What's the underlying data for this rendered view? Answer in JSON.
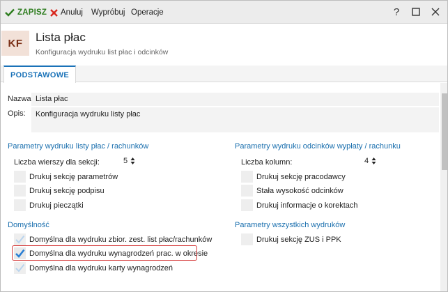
{
  "toolbar": {
    "save_label": "ZAPISZ",
    "cancel_label": "Anuluj",
    "try_label": "Wypróbuj",
    "operations_label": "Operacje",
    "help_label": "?"
  },
  "header": {
    "badge": "KF",
    "title": "Lista płac",
    "subtitle": "Konfiguracja wydruku list płac i odcinków"
  },
  "tabs": [
    {
      "label": "PODSTAWOWE",
      "active": true
    }
  ],
  "form": {
    "name_label": "Nazwa:",
    "name_value": "Lista płac",
    "desc_label": "Opis:",
    "desc_value": "Konfiguracja wydruku listy płac"
  },
  "left_section": {
    "title": "Parametry wydruku listy płac / rachunków",
    "rows_label": "Liczba wierszy dla sekcji:",
    "rows_value": "5",
    "options": [
      {
        "label": "Drukuj sekcję parametrów",
        "checked": false
      },
      {
        "label": "Drukuj sekcję podpisu",
        "checked": false
      },
      {
        "label": "Drukuj pieczątki",
        "checked": false
      }
    ]
  },
  "right_section": {
    "title": "Parametry wydruku odcinków wypłaty / rachunku",
    "cols_label": "Liczba kolumn:",
    "cols_value": "4",
    "options": [
      {
        "label": "Drukuj sekcję pracodawcy",
        "checked": false
      },
      {
        "label": "Stała wysokość odcinków",
        "checked": false
      },
      {
        "label": "Drukuj informacje o korektach",
        "checked": false
      }
    ]
  },
  "defaults_section": {
    "title": "Domyślność",
    "options": [
      {
        "label": "Domyślna dla wydruku zbior. zest. list płac/rachunków",
        "checked": "faded"
      },
      {
        "label": "Domyślna dla wydruku wynagrodzeń prac. w okresie",
        "checked": "checked"
      },
      {
        "label": "Domyślna dla wydruku karty wynagrodzeń",
        "checked": "faded"
      }
    ]
  },
  "all_section": {
    "title": "Parametry wszystkich wydruków",
    "options": [
      {
        "label": "Drukuj sekcję ZUS i PPK",
        "checked": false
      }
    ]
  },
  "colors": {
    "accent": "#1a72b8",
    "save_green": "#2e7d1f",
    "cancel_red": "#d8261c",
    "highlight": "#d53a3a",
    "check_blue": "#2a7fd4"
  }
}
